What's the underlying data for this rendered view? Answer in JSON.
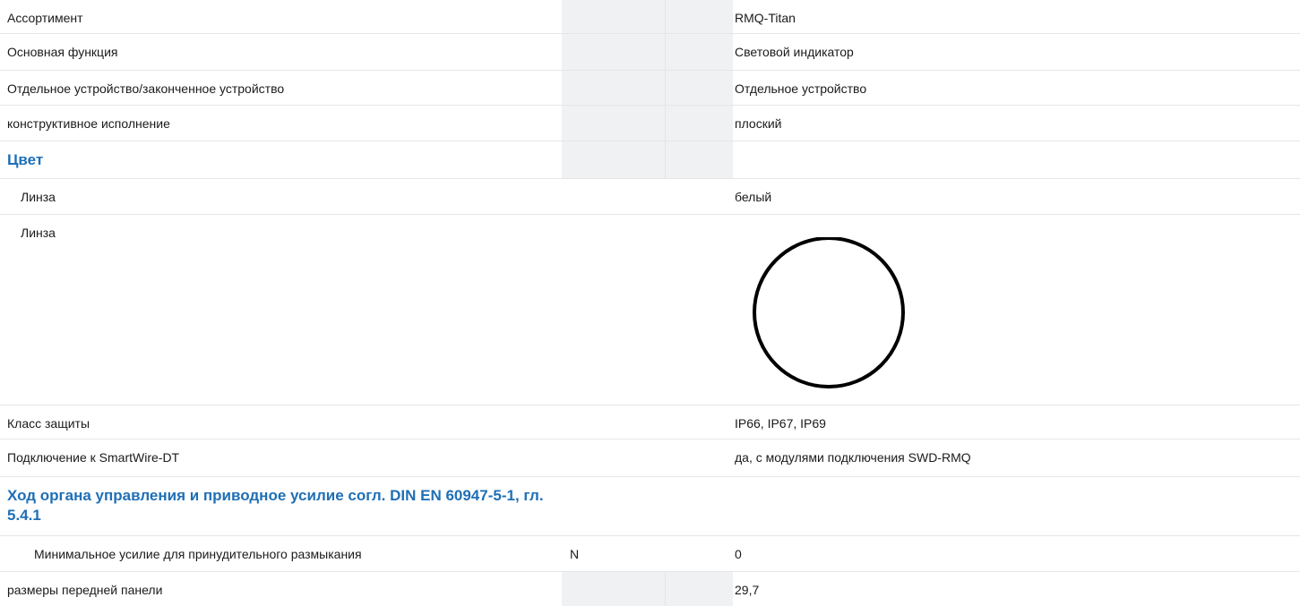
{
  "rows": [
    {
      "label": "Ассортимент",
      "unit": "",
      "value": "RMQ-Titan"
    },
    {
      "label": "Основная функция",
      "unit": "",
      "value": "Световой индикатор"
    },
    {
      "label": "Отдельное устройство/законченное устройство",
      "unit": "",
      "value": "Отдельное устройство"
    },
    {
      "label": "конструктивное исполнение",
      "unit": "",
      "value": "плоский"
    },
    {
      "heading": "Цвет"
    },
    {
      "label": "Линза",
      "unit": "",
      "value": "белый"
    },
    {
      "label": "Линза",
      "unit": "",
      "value": "",
      "swatch": "white-circle"
    },
    {
      "label": "Класс защиты",
      "unit": "",
      "value": "IP66, IP67, IP69"
    },
    {
      "label": "Подключение к SmartWire-DT",
      "unit": "",
      "value": "да, с модулями подключения SWD-RMQ"
    },
    {
      "heading": "Ход органа управления и приводное усилие согл. DIN EN 60947-5-1, гл. 5.4.1"
    },
    {
      "label": "Минимальное усилие для принудительного размыкания",
      "unit": "N",
      "value": "0"
    },
    {
      "label": "размеры передней панели",
      "unit": "",
      "value": "29,7"
    }
  ],
  "colors": {
    "heading": "#1f6fb5",
    "shade": "#f0f1f3",
    "divider": "#e6e6e6"
  },
  "swatch_color": "#ffffff"
}
